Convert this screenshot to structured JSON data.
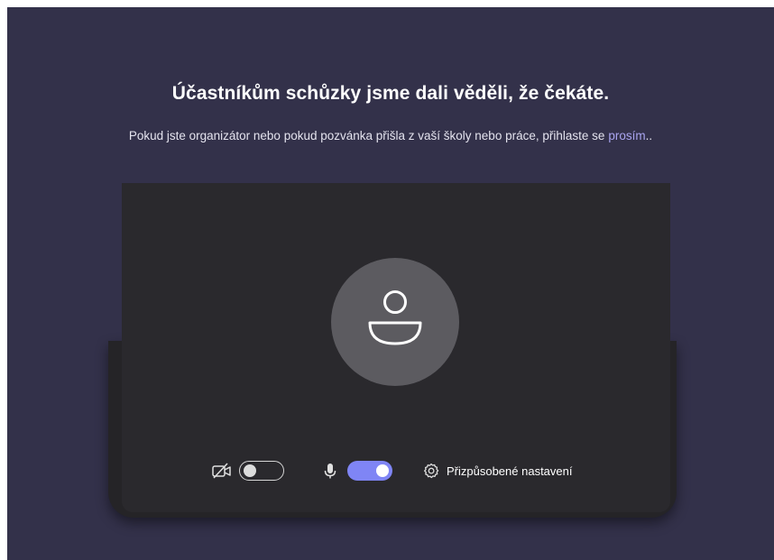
{
  "lobby": {
    "title": "Účastníkům schůzky jsme dali věděli, že čekáte.",
    "subtitle": "Pokud jste organizátor nebo pokud pozvánka přišla z vaší školy nebo práce, přihlaste se",
    "signin_link": "prosím",
    "signin_suffix": ".."
  },
  "controls": {
    "camera": {
      "icon": "camera-off-icon",
      "enabled": false
    },
    "microphone": {
      "icon": "microphone-icon",
      "enabled": true
    },
    "settings": {
      "icon": "gear-icon",
      "label": "Přizpůsobené nastavení"
    }
  },
  "colors": {
    "background": "#33314a",
    "preview": "#2a292d",
    "avatar": "#5c5b60",
    "accent": "#7f85f5",
    "link": "#aaa5f0"
  }
}
